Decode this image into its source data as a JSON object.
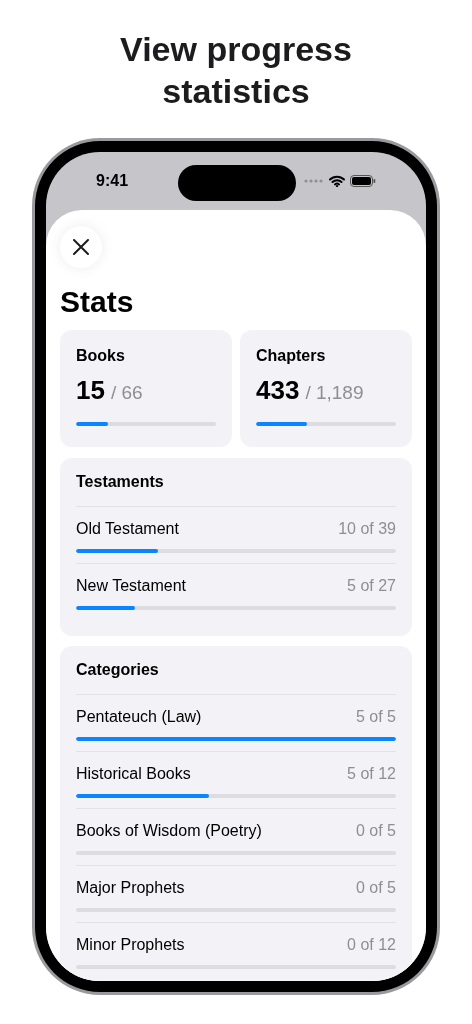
{
  "headline": "View progress statistics",
  "status_bar": {
    "time": "9:41"
  },
  "sheet": {
    "title": "Stats"
  },
  "summary": [
    {
      "label": "Books",
      "value": "15",
      "total": "/ 66",
      "level": 0.227
    },
    {
      "label": "Chapters",
      "value": "433",
      "total": "/ 1,189",
      "level": 0.364
    }
  ],
  "sections": [
    {
      "title": "Testaments",
      "rows": [
        {
          "name": "Old Testament",
          "count": "10 of 39",
          "level": 0.256
        },
        {
          "name": "New Testament",
          "count": "5 of 27",
          "level": 0.185
        }
      ]
    },
    {
      "title": "Categories",
      "rows": [
        {
          "name": "Pentateuch (Law)",
          "count": "5 of 5",
          "level": 1
        },
        {
          "name": "Historical Books",
          "count": "5 of 12",
          "level": 0.417
        },
        {
          "name": "Books of Wisdom (Poetry)",
          "count": "0 of 5",
          "level": 0
        },
        {
          "name": "Major Prophets",
          "count": "0 of 5",
          "level": 0
        },
        {
          "name": "Minor Prophets",
          "count": "0 of 12",
          "level": 0
        }
      ]
    }
  ]
}
